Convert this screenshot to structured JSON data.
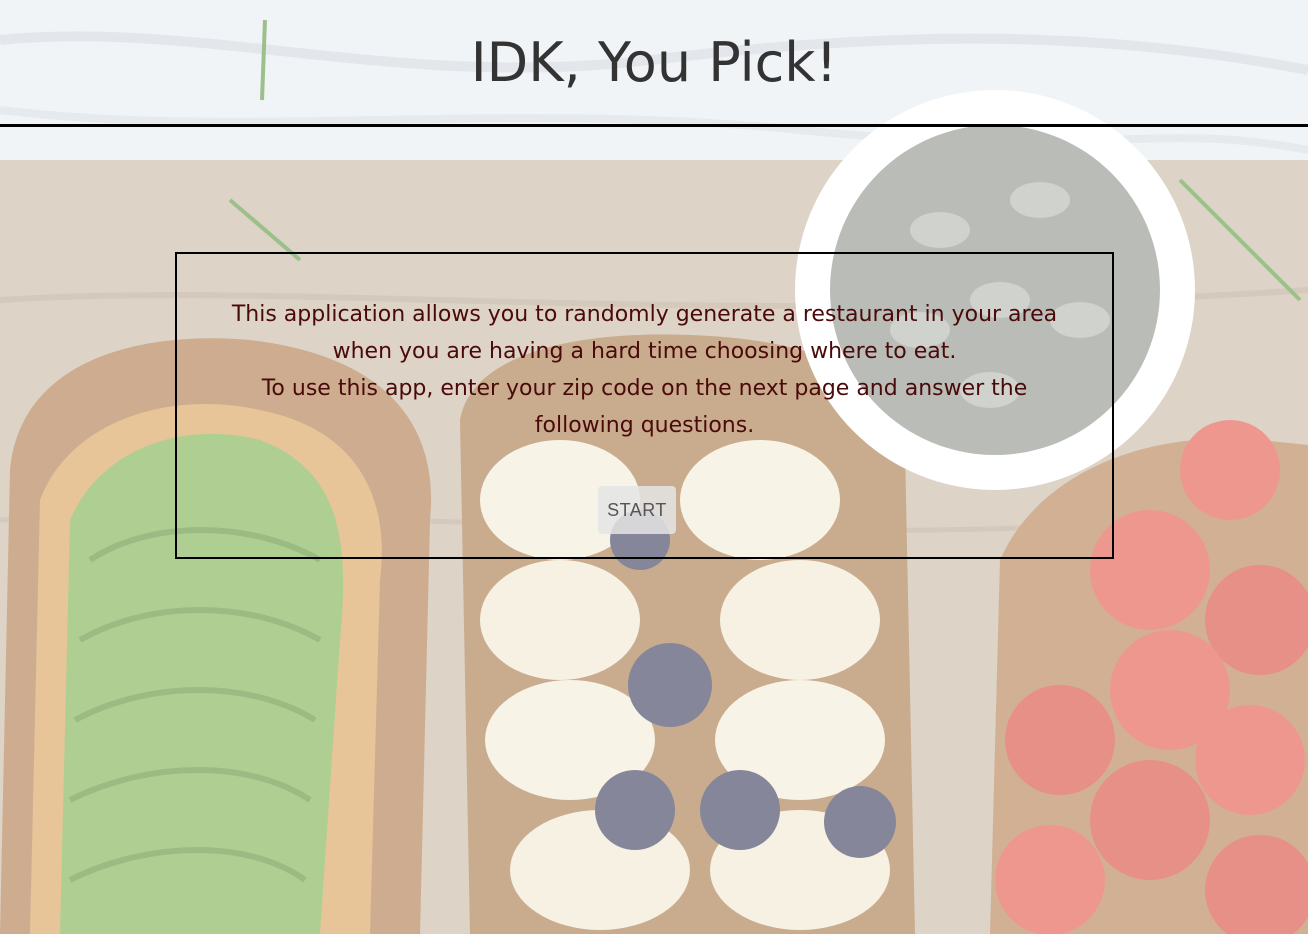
{
  "header": {
    "title": "IDK, You Pick!"
  },
  "intro": {
    "lines": [
      "This application allows you to randomly generate a restaurant in your area",
      "when you are having a hard time choosing where to eat.",
      "To use this app, enter your zip code on the next page and answer the",
      "following questions."
    ]
  },
  "start_button": {
    "label": "START"
  },
  "colors": {
    "title_text": "#333333",
    "intro_text": "#4a0a0a",
    "divider": "#000000",
    "button_bg": "#e4e4e4",
    "button_text": "#555555"
  }
}
